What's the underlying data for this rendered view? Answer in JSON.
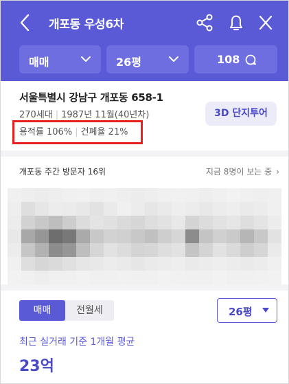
{
  "header": {
    "title": "개포동 우성6차",
    "filters": [
      {
        "label": "매매"
      },
      {
        "label": "26평"
      }
    ],
    "comments": {
      "count": "108"
    }
  },
  "complex": {
    "address": "서울특별시 강남구 개포동 658-1",
    "households": "270세대",
    "built": "1987년 11월(40년차)",
    "far": "용적률 106%",
    "bcr": "건폐율 21%",
    "tour_button": "3D 단지투어"
  },
  "visitors": {
    "rank": "개포동 주간 방문자 16위",
    "viewing": "지금 8명이 보는 중"
  },
  "price_panel": {
    "tabs": [
      "매매",
      "전월세"
    ],
    "area": "26평",
    "avg_label": "최근 실거래 기준 1개월 평균",
    "price": "23억"
  },
  "colors": {
    "brand": "#5a5ad6",
    "highlight_box": "#e8211f"
  },
  "icons": [
    "back-icon",
    "share-icon",
    "bell-icon",
    "close-icon",
    "chevron-down-icon",
    "chat-icon",
    "chevron-right-icon"
  ]
}
